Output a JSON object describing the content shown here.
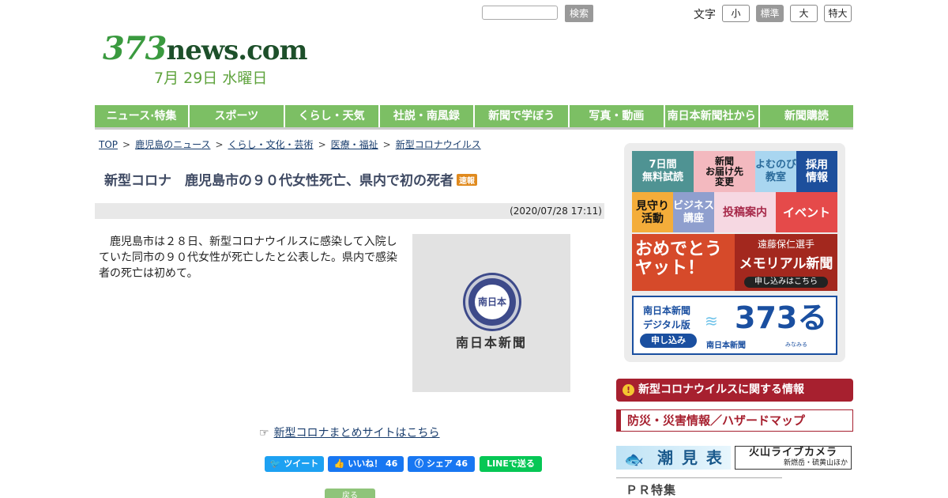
{
  "header": {
    "search_button": "検索",
    "font_size_label": "文字",
    "font_sizes": [
      "小",
      "標準",
      "大",
      "特大"
    ],
    "logo_number": "373",
    "logo_domain": "news.com",
    "date": "7月 29日 水曜日"
  },
  "nav": {
    "items": [
      "ニュース·特集",
      "スポーツ",
      "くらし・天気",
      "社説・南風録",
      "新聞で学ぼう",
      "写真・動画",
      "南日本新聞社から",
      "新聞購読"
    ]
  },
  "breadcrumb": {
    "items": [
      "TOP",
      "鹿児島のニュース",
      "くらし・文化・芸術",
      "医療・福祉",
      "新型コロナウイルス"
    ],
    "separator": ">"
  },
  "article": {
    "title": "新型コロナ　鹿児島市の９０代女性死亡、県内で初の死者",
    "badge": "速報",
    "timestamp": "(2020/07/28 17:11)",
    "body": "鹿児島市は２８日、新型コロナウイルスに感染して入院していた同市の９０代女性が死亡したと公表した。県内で感染者の死亡は初めて。",
    "photo_emblem": "南日本",
    "photo_caption": "南日本新聞",
    "summary_link": "新型コロナまとめサイトはこちら",
    "back_button": "戻る"
  },
  "share": {
    "tweet": "ツイート",
    "like": "いいね！ 46",
    "fb_share": "シェア 46",
    "line": "LINEで送る"
  },
  "sidebar": {
    "tiles": {
      "trial": "7日間\n無料試読",
      "delivery": "新聞\nお届け先\n変更",
      "yomunobi": "よむのび\n教室",
      "recruit": "採用\n情報",
      "mimamori": "見守り\n活動",
      "business": "ビジネス\n講座",
      "toukou": "投稿案内",
      "event": "イベント"
    },
    "banner_left": "おめでとう\nヤット！",
    "banner_right_name": "遠藤保仁選手",
    "banner_right_title": "メモリアル新聞",
    "banner_right_cta": "申し込みはこちら",
    "digital_line1": "南日本新聞",
    "digital_line2": "デジタル版",
    "digital_cta": "申し込み",
    "digital_logo": "373る",
    "digital_sub": "南日本新聞",
    "digital_small": "みなみる",
    "corona_info": "新型コロナウイルスに関する情報",
    "bousai": "防災・災害情報／ハザードマップ",
    "shiomi": "潮 見 表",
    "kazan_title": "火山ライブカメラ",
    "kazan_sub": "新燃岳・硫黄山ほか",
    "pr_title": "ＰＲ特集"
  },
  "colors": {
    "nav_green": "#7cbf64",
    "title_navy": "#3f4a63",
    "accent_red": "#a7202f"
  }
}
